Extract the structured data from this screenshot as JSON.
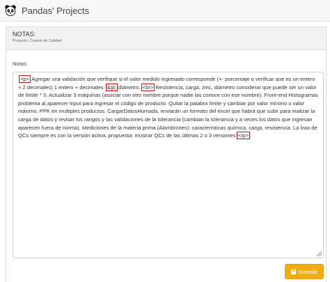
{
  "app": {
    "title": "Pandas' Projects"
  },
  "card": {
    "title": "NOTAS:",
    "subtitle": "Proyecto: Control de Calidad"
  },
  "form": {
    "label": "Notas:",
    "segments": [
      {
        "t": "tag",
        "v": "<p>"
      },
      {
        "t": "text",
        "v": "Agregar una validación que verifique si el valor medido ingresado corresponde (+- porcentaje o verificar que es un entero + 2 decimales) 1 entero + decimales "
      },
      {
        "t": "tag",
        "v": "&gt;"
      },
      {
        "t": "text",
        "v": "diámetro."
      },
      {
        "t": "tag",
        "v": "<br>"
      },
      {
        "t": "text",
        "v": "Resistencia, carga, zinc, diámetro considerar que puede ser un valor de límite * 3. Actualizar 3 máquinas (asociar con otro nombre porque nadie las conoce con ese nombre). Front-end Histogramas problema al aparecer input para ingresar el código de producto. Quitar la palabra límite y cambiar por valor mínimo o valor máximo. PPK en multiples productos. CargarDatosHornada, enviarán un formato del excel que habrá que subir para realizar la carga de datos y revisar los rangos y las validaciones de la tolerancia (cambian la tolerancia y a veces los datos que ingresan aparecen fuera de norma). Mediciones de la materia prima (Alambrones): características química, carga, resistencia. La lista de QCs siempre es con la versión activa, propuesta: mostrar QCs de las últimas 2 o 3 versiones"
      },
      {
        "t": "tag",
        "v": "</p>"
      }
    ]
  },
  "actions": {
    "save_label": "Guardar"
  },
  "colors": {
    "accent": "#f0ad13",
    "highlight": "#d01010"
  }
}
